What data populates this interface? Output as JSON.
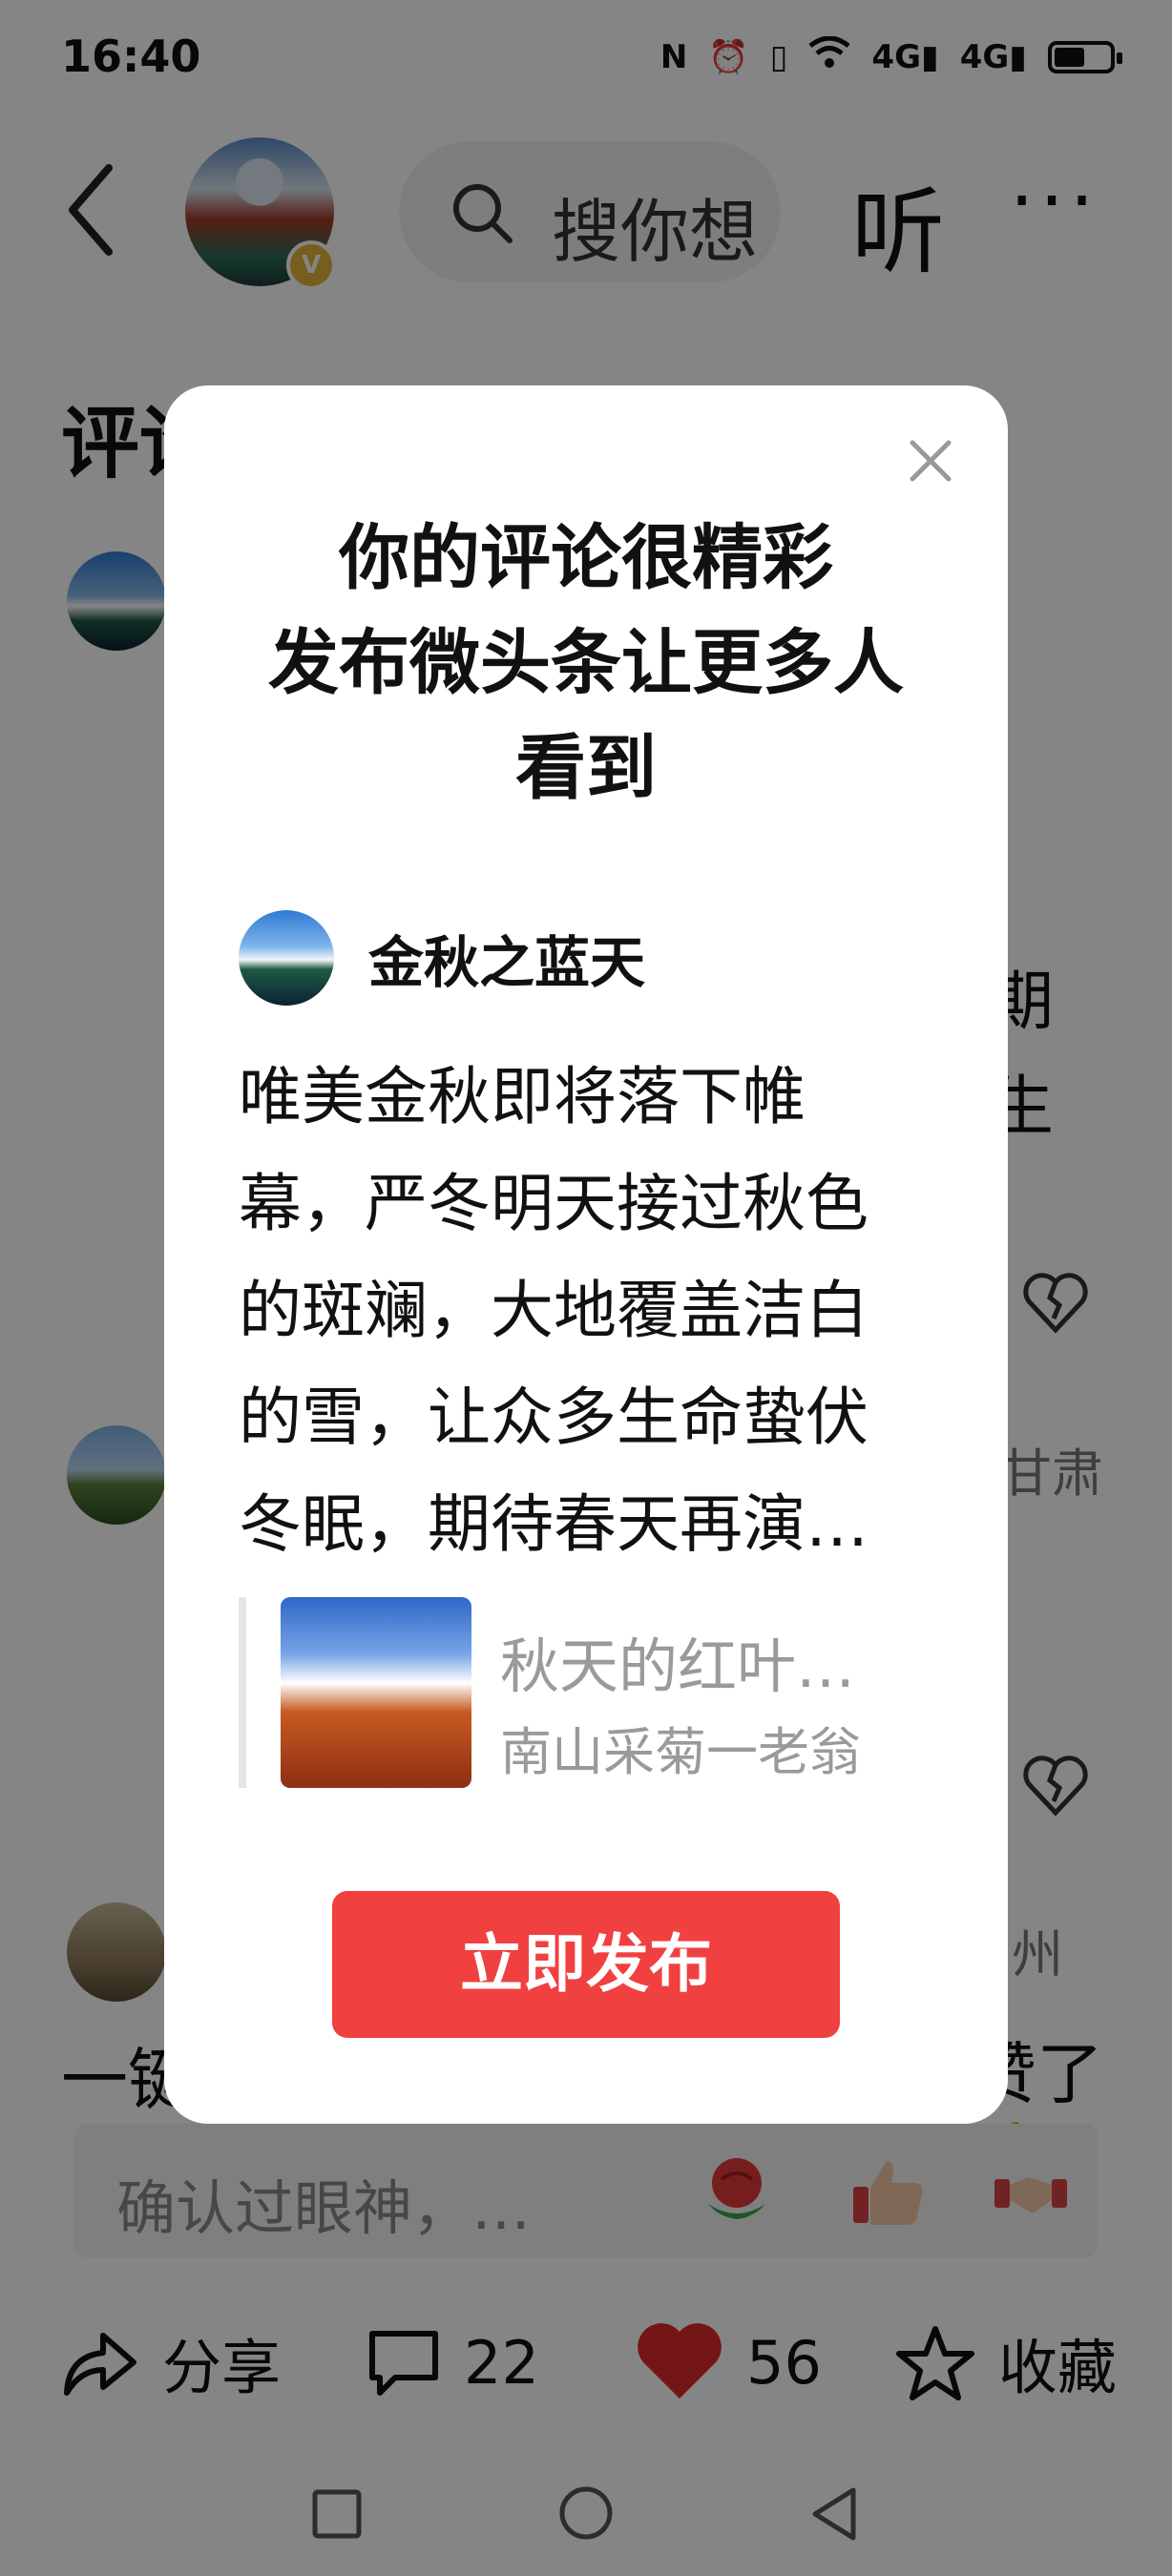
{
  "status_bar": {
    "time": "16:40",
    "icons": [
      "nfc-icon",
      "alarm-icon",
      "vibrate-icon",
      "wifi-icon",
      "signal-4g-icon",
      "signal-4g-icon",
      "battery-icon"
    ],
    "signal_label_1": "4G",
    "signal_label_2": "4G",
    "battery_level": 0.55
  },
  "header": {
    "search_text": "搜你想",
    "listen_label": "听",
    "more_label": "···",
    "verified_mark": "V"
  },
  "background": {
    "section_title": "评论",
    "fragment_right_1": "期",
    "fragment_right_2": "生",
    "location_1": "甘肃",
    "location_2": "州",
    "quick_reply_left": "一键",
    "quick_reply_right": "赞了👍",
    "comment_placeholder": "确认过眼神，…"
  },
  "actions": {
    "share_label": "分享",
    "comment_count": "22",
    "like_count": "56",
    "favorite_label": "收藏"
  },
  "modal": {
    "title_line1": "你的评论很精彩",
    "title_line2": "发布微头条让更多人",
    "title_line3": "看到",
    "author_name": "金秋之蓝天",
    "comment_lines": [
      "唯美金秋即将落下帷",
      "幕，严冬明天接过秋色",
      "的斑斓，大地覆盖洁白",
      "的雪，让众多生命蛰伏",
      "冬眠，期待春天再演…"
    ],
    "quoted_title": "秋天的红叶…",
    "quoted_author": "南山采菊一老翁",
    "publish_label": "立即发布"
  },
  "colors": {
    "publish_button": "#f04040",
    "like_heart": "#e02b2b",
    "verified_badge": "#e2b53b",
    "overlay": "rgba(0,0,0,0.48)"
  }
}
